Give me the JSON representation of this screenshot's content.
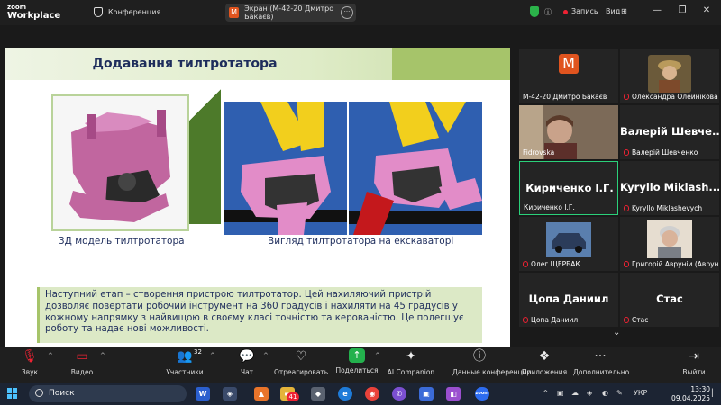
{
  "titlebar": {
    "logo_line1": "zoom",
    "logo_line2": "Workplace",
    "conference_label": "Конференция",
    "share_badge": "M",
    "share_label": "Экран (М-42-20 Дмитро Бакаєв)",
    "share_more": "···",
    "record_label": "Запись",
    "view_label": "Вид",
    "minimize": "—",
    "restore": "❐",
    "close": "✕"
  },
  "slide": {
    "title": "Додавання тилтротатора",
    "caption_left": "3Д модель тилтротатора",
    "caption_right": "Вигляд тилтротатора на екскаваторі",
    "body": "Наступний етап – створення пристрою тилтротатор. Цей нахиляючий пристрій дозволяє повертати робочий інструмент на 360 градусів і нахиляти на 45 градусів у кожному напрямку з найвищою в своєму класі точністю та керованістю. Це полегшує роботу та надає нові можливості."
  },
  "participants": [
    {
      "name": "М-42-20 Дмитро Бакаєв",
      "avatar_letter": "M",
      "display": "avatar",
      "muted": false
    },
    {
      "name": "Олександра Олейнікова",
      "display": "photo",
      "muted": true
    },
    {
      "name": "Fidrovska",
      "display": "video",
      "muted": false
    },
    {
      "name": "Валерій Шевченко",
      "big": "Валерій Шевче...",
      "display": "text",
      "muted": true
    },
    {
      "name": "Кириченко І.Г.",
      "big": "Кириченко І.Г.",
      "display": "text",
      "muted": false,
      "active": true
    },
    {
      "name": "Kyryllo Miklashevych",
      "big": "Kyryllo  Miklash...",
      "display": "text",
      "muted": true
    },
    {
      "name": "Олег ЩЕРБАК",
      "display": "photo",
      "muted": true
    },
    {
      "name": "Григорій Авруніи (Аврун...",
      "display": "photo",
      "muted": true
    },
    {
      "name": "Цопа Даниил",
      "big": "Цопа Даниил",
      "display": "text",
      "muted": true
    },
    {
      "name": "Стас",
      "big": "Стас",
      "display": "text",
      "muted": true
    }
  ],
  "toolbar": {
    "audio": "Звук",
    "video": "Видео",
    "participants": "Участники",
    "participants_count": "32",
    "chat": "Чат",
    "react": "Отреагировать",
    "share": "Поделиться",
    "companion": "AI Companion",
    "info": "Данные конференции",
    "apps": "Приложения",
    "more": "Дополнительно",
    "exit": "Выйти"
  },
  "taskbar": {
    "search_placeholder": "Поиск",
    "chrome_badge": "41",
    "lang": "УКР",
    "time": "13:30",
    "date": "09.04.2025"
  },
  "colors": {
    "accent_green": "#a6c46a",
    "slide_text": "#1e2d5c",
    "share_green": "#23b14d",
    "mic_muted": "#e23333",
    "zoom_avatar": "#e0541f"
  }
}
